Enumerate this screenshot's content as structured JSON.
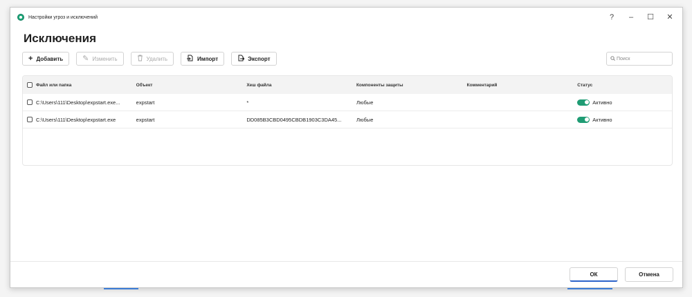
{
  "window": {
    "title": "Настройки угроз и исключений",
    "controls": [
      "?",
      "–",
      "☐",
      "✕"
    ]
  },
  "heading": "Исключения",
  "toolbar": {
    "add_label": "Добавить",
    "edit_label": "Изменить",
    "delete_label": "Удалить",
    "import_label": "Импорт",
    "export_label": "Экспорт"
  },
  "search": {
    "placeholder": "Поиск"
  },
  "table": {
    "columns": [
      "Файл или папка",
      "Объект",
      "Хеш файла",
      "Компоненты защиты",
      "Комментарий",
      "Статус"
    ],
    "rows": [
      {
        "file": "C:\\Users\\111\\Desktop\\expstart.exe...",
        "object": "expstart",
        "hash": "*",
        "components": "Любые",
        "comment": "",
        "status": "Активно",
        "enabled": true
      },
      {
        "file": "C:\\Users\\111\\Desktop\\expstart.exe",
        "object": "expstart",
        "hash": "DD085B3CBD0495CBDB1903C3DA45...",
        "components": "Любые",
        "comment": "",
        "status": "Активно",
        "enabled": true
      }
    ]
  },
  "footer": {
    "ok_label": "ОК",
    "cancel_label": "Отмена"
  },
  "colors": {
    "accent": "#1f9c74",
    "ok_underline": "#2b62c9"
  },
  "icons": {
    "app": "kaspersky-shield-icon",
    "add": "plus-icon",
    "edit": "pencil-icon",
    "delete": "trash-icon",
    "import": "import-icon",
    "export": "export-icon",
    "search": "search-icon"
  }
}
